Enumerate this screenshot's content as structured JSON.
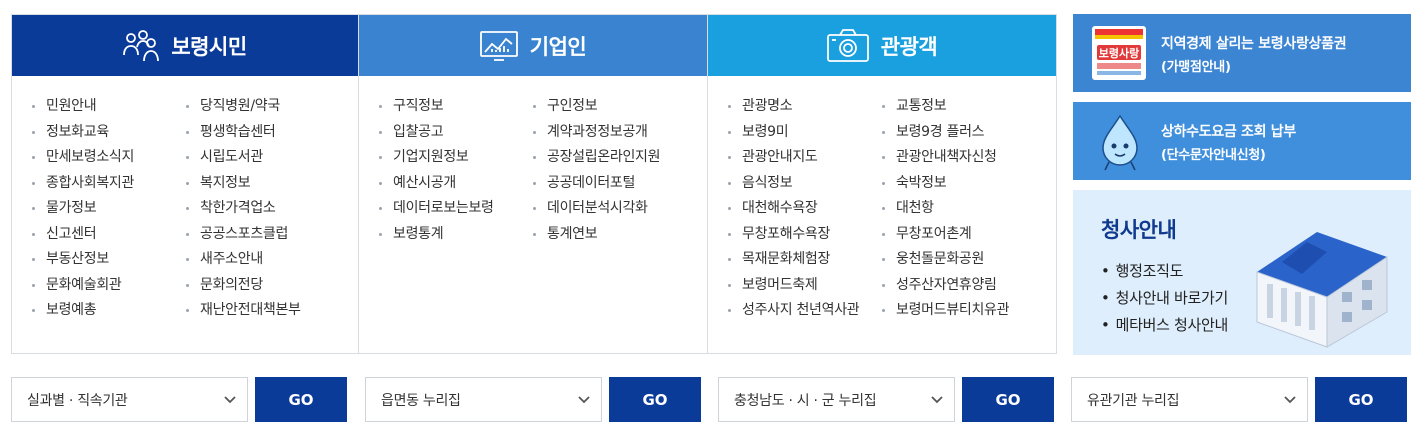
{
  "columns": [
    {
      "title": "보령시민",
      "icon": "people-icon",
      "color": "#0a3b99",
      "items": [
        "민원안내",
        "당직병원/약국",
        "정보화교육",
        "평생학습센터",
        "만세보령소식지",
        "시립도서관",
        "종합사회복지관",
        "복지정보",
        "물가정보",
        "착한가격업소",
        "신고센터",
        "공공스포츠클럽",
        "부동산정보",
        "새주소안내",
        "문화예술회관",
        "문화의전당",
        "보령예총",
        "재난안전대책본부"
      ]
    },
    {
      "title": "기업인",
      "icon": "chart-monitor-icon",
      "color": "#3a83d0",
      "items": [
        "구직정보",
        "구인정보",
        "입찰공고",
        "계약과정정보공개",
        "기업지원정보",
        "공장설립온라인지원",
        "예산시공개",
        "공공데이터포털",
        "데이터로보는보령",
        "데이터분석시각화",
        "보령통계",
        "통계연보"
      ]
    },
    {
      "title": "관광객",
      "icon": "camera-icon",
      "color": "#1a9fdf",
      "items": [
        "관광명소",
        "교통정보",
        "보령9미",
        "보령9경 플러스",
        "관광안내지도",
        "관광안내책자신청",
        "음식정보",
        "숙박정보",
        "대천해수욕장",
        "대천항",
        "무창포해수욕장",
        "무창포어촌계",
        "목재문화체험장",
        "웅천돌문화공원",
        "보령머드축제",
        "성주산자연휴양림",
        "성주사지 천년역사관",
        "보령머드뷰티치유관"
      ]
    }
  ],
  "banners": {
    "gift": {
      "line1": "지역경제 살리는 보령사랑상품권",
      "line2": "(가맹점안내)",
      "logo_text": "보령사랑"
    },
    "water": {
      "line1": "상하수도요금 조회 납부",
      "line2": "(단수문자안내신청)"
    },
    "office": {
      "title": "청사안내",
      "items": [
        "행정조직도",
        "청사안내 바로가기",
        "메타버스 청사안내"
      ]
    }
  },
  "selects": [
    {
      "value": "실과별 · 직속기관",
      "go": "GO"
    },
    {
      "value": "읍면동 누리집",
      "go": "GO"
    },
    {
      "value": "충청남도 · 시 · 군 누리집",
      "go": "GO"
    },
    {
      "value": "유관기관 누리집",
      "go": "GO"
    }
  ]
}
